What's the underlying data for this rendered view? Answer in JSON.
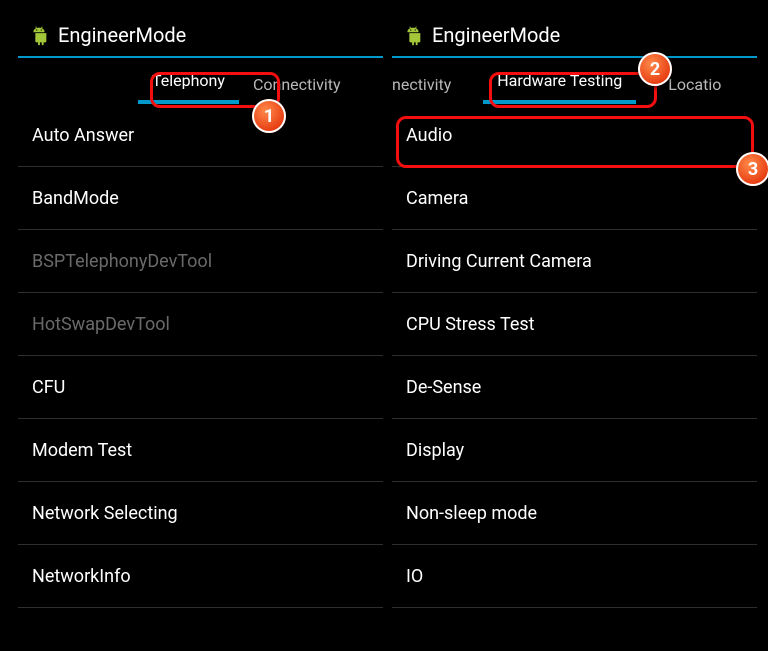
{
  "callouts": {
    "one": "1",
    "two": "2",
    "three": "3"
  },
  "left": {
    "title": "EngineerMode",
    "tabs": {
      "active": "Telephony",
      "next": "Connectivity"
    },
    "items": [
      {
        "label": "Auto Answer",
        "disabled": false
      },
      {
        "label": "BandMode",
        "disabled": false
      },
      {
        "label": "BSPTelephonyDevTool",
        "disabled": true
      },
      {
        "label": "HotSwapDevTool",
        "disabled": true
      },
      {
        "label": "CFU",
        "disabled": false
      },
      {
        "label": "Modem Test",
        "disabled": false
      },
      {
        "label": "Network Selecting",
        "disabled": false
      },
      {
        "label": "NetworkInfo",
        "disabled": false
      }
    ]
  },
  "right": {
    "title": "EngineerMode",
    "tabs": {
      "prev": "nectivity",
      "active": "Hardware Testing",
      "next": "Locatio"
    },
    "items": [
      {
        "label": "Audio",
        "disabled": false
      },
      {
        "label": "Camera",
        "disabled": false
      },
      {
        "label": "Driving Current Camera",
        "disabled": false
      },
      {
        "label": "CPU Stress Test",
        "disabled": false
      },
      {
        "label": "De-Sense",
        "disabled": false
      },
      {
        "label": "Display",
        "disabled": false
      },
      {
        "label": "Non-sleep mode",
        "disabled": false
      },
      {
        "label": "IO",
        "disabled": false
      }
    ]
  }
}
